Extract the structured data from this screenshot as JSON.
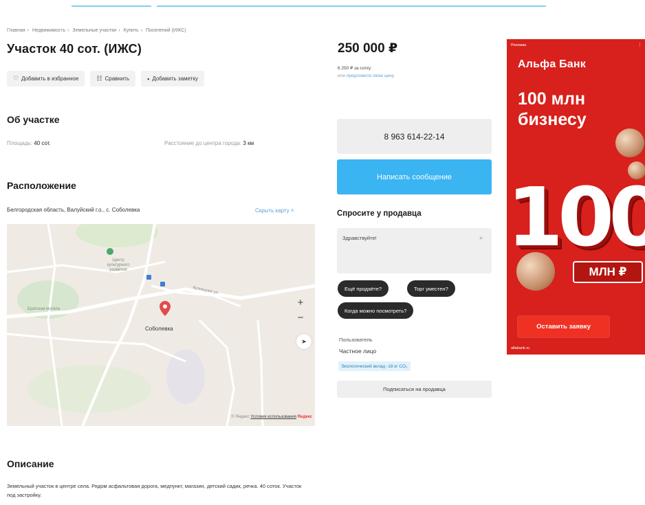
{
  "breadcrumbs": [
    "Главная",
    "Недвижимость",
    "Земельные участки",
    "Купить",
    "Поселений (ИЖС)"
  ],
  "listing": {
    "title": "Участок 40 сот. (ИЖС)",
    "actions": {
      "favorite": "Добавить в избранное",
      "compare": "Сравнить",
      "note": "Добавить заметку"
    }
  },
  "about": {
    "heading": "Об участке",
    "area_label": "Площадь:",
    "area_value": "40 сот.",
    "distance_label": "Расстояние до центра города:",
    "distance_value": "3 км"
  },
  "location": {
    "heading": "Расположение",
    "address": "Белгородская область, Валуйский г.о., с. Соболевка",
    "toggle_map": "Скрыть карту ˄",
    "map": {
      "pin_label": "Соболевка",
      "poi_label": "Центр культурного развития",
      "street_label": "Кузнецова ул.",
      "area_label": "Братская могила",
      "zoom_in": "+",
      "zoom_out": "−",
      "copyright": "© Яндекс",
      "terms": "Условия использования",
      "brand": "Яндекс"
    }
  },
  "price": {
    "value": "250 000 ₽",
    "per_unit": "6 250 ₽ за сотку",
    "offer_prefix": "или",
    "offer_link": "предложите свою цену"
  },
  "contact": {
    "phone": "8 963 614-22-14",
    "message_button": "Написать сообщение",
    "ask_heading": "Спросите у продавца",
    "ask_placeholder": "Здравствуйте!",
    "quick_questions": [
      "Ещё продаёте?",
      "Торг уместен?",
      "Когда можно посмотреть?"
    ]
  },
  "seller": {
    "type": "Пользователь",
    "name": "Частное лицо",
    "eco_badge": "Экологический вклад -18 кг CO₂",
    "subscribe": "Подписаться на продавца"
  },
  "description": {
    "heading": "Описание",
    "text": "Земельный участок в центре села. Рядом асфальтовая дорога, медпункт, магазин, детский садик, речка. 40 соток. Участок под застройку."
  },
  "ad": {
    "label": "Реклама",
    "bank": "Альфа Банк",
    "headline": "100 млн бизнесу",
    "big_number": "100",
    "unit": "МЛН ₽",
    "cta": "Оставить заявку",
    "footer": "alfabank.ru",
    "colors": {
      "background": "#d8201c",
      "cta": "#ef3124"
    }
  },
  "colors": {
    "accent_blue": "#3bb4f2",
    "link_blue": "#5b9fd6",
    "chip_dark": "#2b2b2b"
  }
}
